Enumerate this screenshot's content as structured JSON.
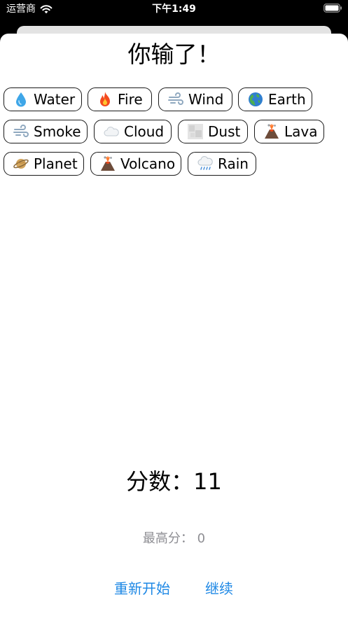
{
  "status_bar": {
    "carrier": "运营商",
    "time": "下午1:49"
  },
  "game": {
    "title": "你输了！",
    "elements": [
      {
        "label": "Water",
        "icon": "water-drop-icon",
        "color": "#3ea6e8"
      },
      {
        "label": "Fire",
        "icon": "fire-icon",
        "color": "#f57c1f"
      },
      {
        "label": "Wind",
        "icon": "wind-icon",
        "color": "#9bb3c8"
      },
      {
        "label": "Earth",
        "icon": "earth-globe-icon",
        "color": "#2f7fd0"
      },
      {
        "label": "Smoke",
        "icon": "smoke-icon",
        "color": "#9bb3c8"
      },
      {
        "label": "Cloud",
        "icon": "cloud-icon",
        "color": "#d6dde4"
      },
      {
        "label": "Dust",
        "icon": "dust-icon",
        "color": "#c9c9c9"
      },
      {
        "label": "Lava",
        "icon": "volcano-icon",
        "color": "#7a5a44"
      },
      {
        "label": "Planet",
        "icon": "planet-icon",
        "color": "#d4a55b"
      },
      {
        "label": "Volcano",
        "icon": "volcano-icon",
        "color": "#7a5a44"
      },
      {
        "label": "Rain",
        "icon": "rain-cloud-icon",
        "color": "#8fb8d8"
      }
    ],
    "score_label": "分数：11",
    "best_label": "最高分： 0",
    "restart_label": "重新开始",
    "continue_label": "继续"
  },
  "colors": {
    "accent": "#1e88e5",
    "muted_text": "#8e8e93"
  }
}
